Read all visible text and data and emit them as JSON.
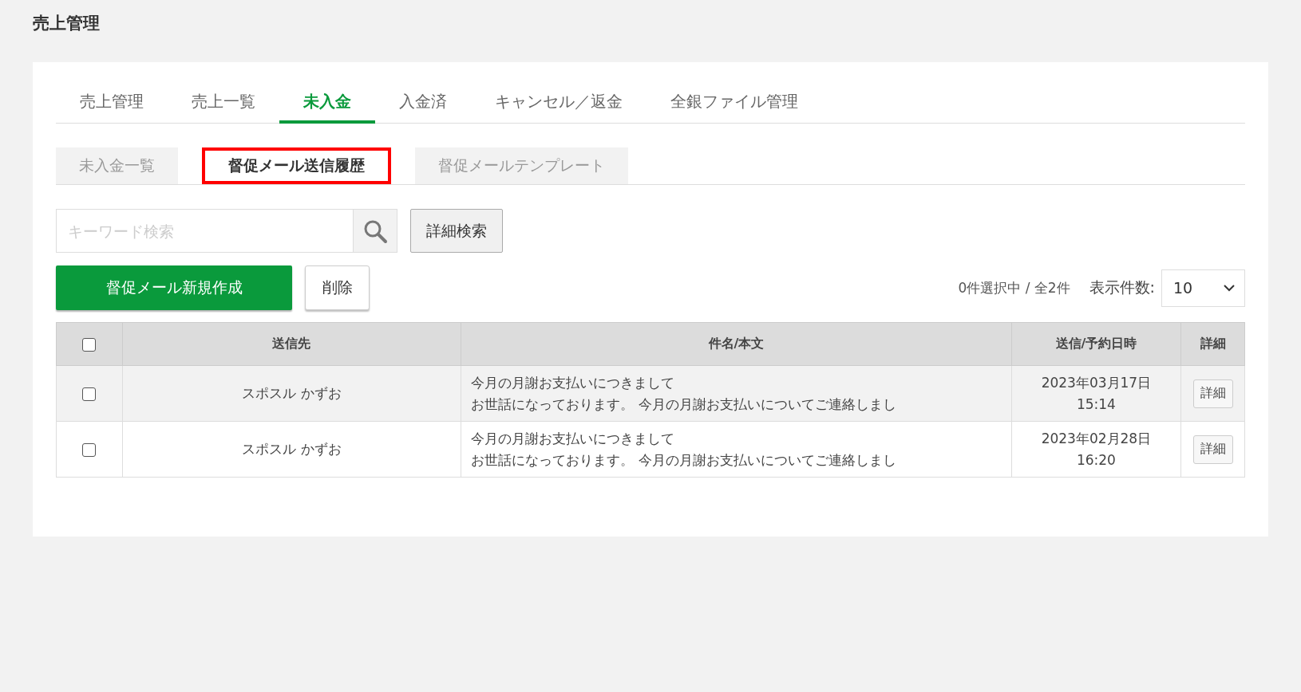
{
  "page_title": "売上管理",
  "tabs": [
    {
      "label": "売上管理",
      "selected": false
    },
    {
      "label": "売上一覧",
      "selected": false
    },
    {
      "label": "未入金",
      "selected": true
    },
    {
      "label": "入金済",
      "selected": false
    },
    {
      "label": "キャンセル／返金",
      "selected": false
    },
    {
      "label": "全銀ファイル管理",
      "selected": false
    }
  ],
  "sub_tabs": [
    {
      "label": "未入金一覧",
      "selected": false,
      "highlighted": false
    },
    {
      "label": "督促メール送信履歴",
      "selected": true,
      "highlighted": true
    },
    {
      "label": "督促メールテンプレート",
      "selected": false,
      "highlighted": false
    }
  ],
  "search": {
    "placeholder": "キーワード検索",
    "advanced_button": "詳細検索"
  },
  "actions": {
    "create_button": "督促メール新規作成",
    "delete_button": "削除"
  },
  "selection_summary": "0件選択中 / 全2件",
  "page_size": {
    "label": "表示件数:",
    "value": "10"
  },
  "table": {
    "select_all_checked": false,
    "columns": [
      "送信先",
      "件名/本文",
      "送信/予約日時",
      "詳細"
    ],
    "rows": [
      {
        "checked": false,
        "recipient": "スポスル かずお",
        "subject": "今月の月謝お支払いにつきまして",
        "body": "お世話になっております。 今月の月謝お支払いについてご連絡しまし",
        "date": "2023年03月17日",
        "time": "15:14",
        "detail_button": "詳細"
      },
      {
        "checked": false,
        "recipient": "スポスル かずお",
        "subject": "今月の月謝お支払いにつきまして",
        "body": "お世話になっております。 今月の月謝お支払いについてご連絡しまし",
        "date": "2023年02月28日",
        "time": "16:20",
        "detail_button": "詳細"
      }
    ]
  }
}
